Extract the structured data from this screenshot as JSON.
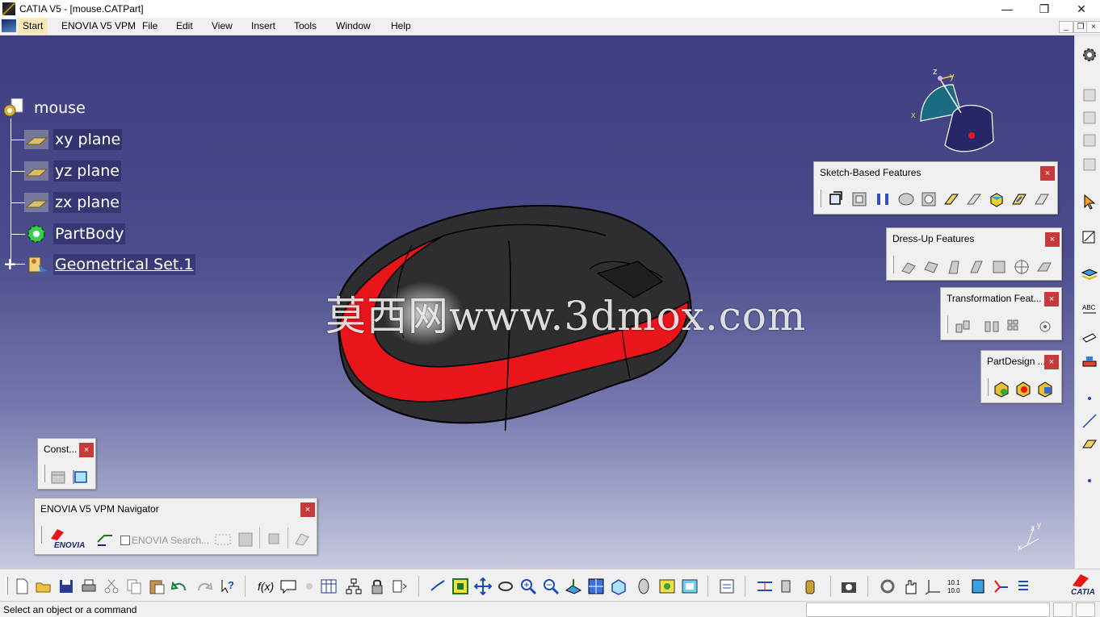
{
  "window": {
    "title": "CATIA V5 - [mouse.CATPart]",
    "min_glyph": "—",
    "restore_glyph": "❐",
    "close_glyph": "✕"
  },
  "menu": {
    "start": "Start",
    "enovia": "ENOVIA V5 VPM",
    "items": [
      "File",
      "Edit",
      "View",
      "Insert",
      "Tools",
      "Window",
      "Help"
    ]
  },
  "tree": {
    "root": "mouse",
    "nodes": [
      "xy plane",
      "yz plane",
      "zx plane",
      "PartBody",
      "Geometrical Set.1"
    ],
    "expand_glyph": "+"
  },
  "compass": {
    "x_label": "x",
    "y_label": "y",
    "z_label": "z"
  },
  "small_axes": {
    "x_label": "x",
    "y_label": "y",
    "z_label": "z"
  },
  "watermark": "莫西网www.3dmox.com",
  "panels": {
    "sketch_based": {
      "title": "Sketch-Based Features",
      "close": "×"
    },
    "dress_up": {
      "title": "Dress-Up Features",
      "close": "×"
    },
    "transformation": {
      "title": "Transformation Feat...",
      "close": "×"
    },
    "partdesign": {
      "title": "PartDesign ...",
      "close": "×"
    },
    "constraints": {
      "title": "Const...",
      "close": "×"
    },
    "enovia_nav": {
      "title": "ENOVIA V5 VPM Navigator",
      "close": "×",
      "logo_text": "ENOVIA",
      "search": "ENOVIA Search..."
    }
  },
  "catia_logo": "CATIA",
  "status": {
    "text": "Select an object or a command"
  },
  "colors": {
    "accent_red": "#e8151a",
    "body_dark": "#333333",
    "close_red": "#c8393b",
    "viewport_top": "#3e3e80"
  }
}
